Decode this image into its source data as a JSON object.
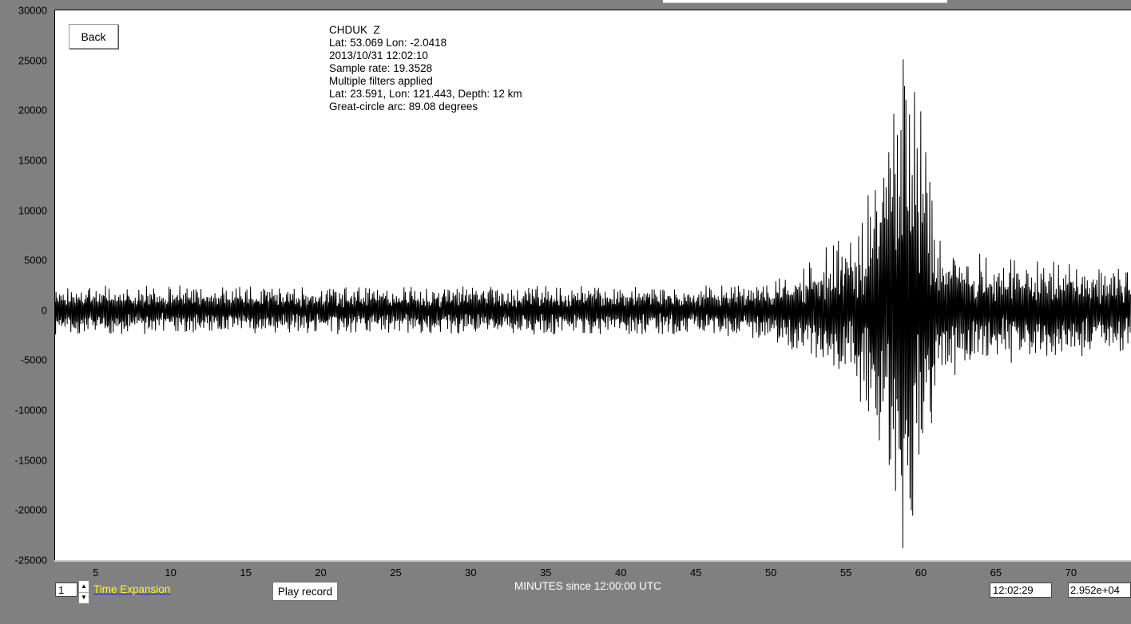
{
  "controls": {
    "back_label": "Back",
    "play_record_label": "Play record",
    "time_expansion_value": "1",
    "time_expansion_label": "Time Expansion",
    "time_readout": "12:02:29",
    "amplitude_readout": "2.952e+04"
  },
  "info": {
    "lines": [
      "CHDUK  Z",
      "Lat: 53.069 Lon: -2.0418",
      "2013/10/31 12:02:10",
      "Sample rate: 19.3528",
      "Multiple filters applied",
      "Lat: 23.591, Lon: 121.443, Depth: 12 km",
      "Great-circle arc: 89.08 degrees"
    ]
  },
  "chart_data": {
    "type": "line",
    "xlabel": "MINUTES since 12:00:00 UTC",
    "ylabel": "",
    "xlim": [
      2.3,
      74
    ],
    "ylim": [
      -25000,
      30000
    ],
    "x_ticks": [
      "5",
      "10",
      "15",
      "20",
      "25",
      "30",
      "35",
      "40",
      "45",
      "50",
      "55",
      "60",
      "65",
      "70"
    ],
    "y_ticks": [
      "30000",
      "25000",
      "20000",
      "15000",
      "10000",
      "5000",
      "0",
      "-5000",
      "-10000",
      "-15000",
      "-20000",
      "-25000"
    ],
    "series": [
      {
        "line_color": "#000000",
        "envelope": [
          {
            "x": 2.3,
            "amp": 2500
          },
          {
            "x": 45,
            "amp": 2500
          },
          {
            "x": 50,
            "amp": 3000
          },
          {
            "x": 53,
            "amp": 5500
          },
          {
            "x": 55,
            "amp": 7000
          },
          {
            "x": 56.5,
            "amp": 10500
          },
          {
            "x": 58,
            "amp": 18000
          },
          {
            "x": 58.8,
            "amp": 24000
          },
          {
            "x": 59.6,
            "amp": 22000
          },
          {
            "x": 60.3,
            "amp": 19000
          },
          {
            "x": 61,
            "amp": 8000
          },
          {
            "x": 63,
            "amp": 5500
          },
          {
            "x": 68,
            "amp": 5000
          },
          {
            "x": 74,
            "amp": 4000
          }
        ],
        "peaks": [
          {
            "x": 58.8,
            "y": 25100
          },
          {
            "x": 58.8,
            "y": -23800
          },
          {
            "x": 59.4,
            "y": -20000
          },
          {
            "x": 60,
            "y": 19900
          },
          {
            "x": 56.5,
            "y": 11500
          },
          {
            "x": 57,
            "y": -9800
          }
        ]
      }
    ]
  }
}
